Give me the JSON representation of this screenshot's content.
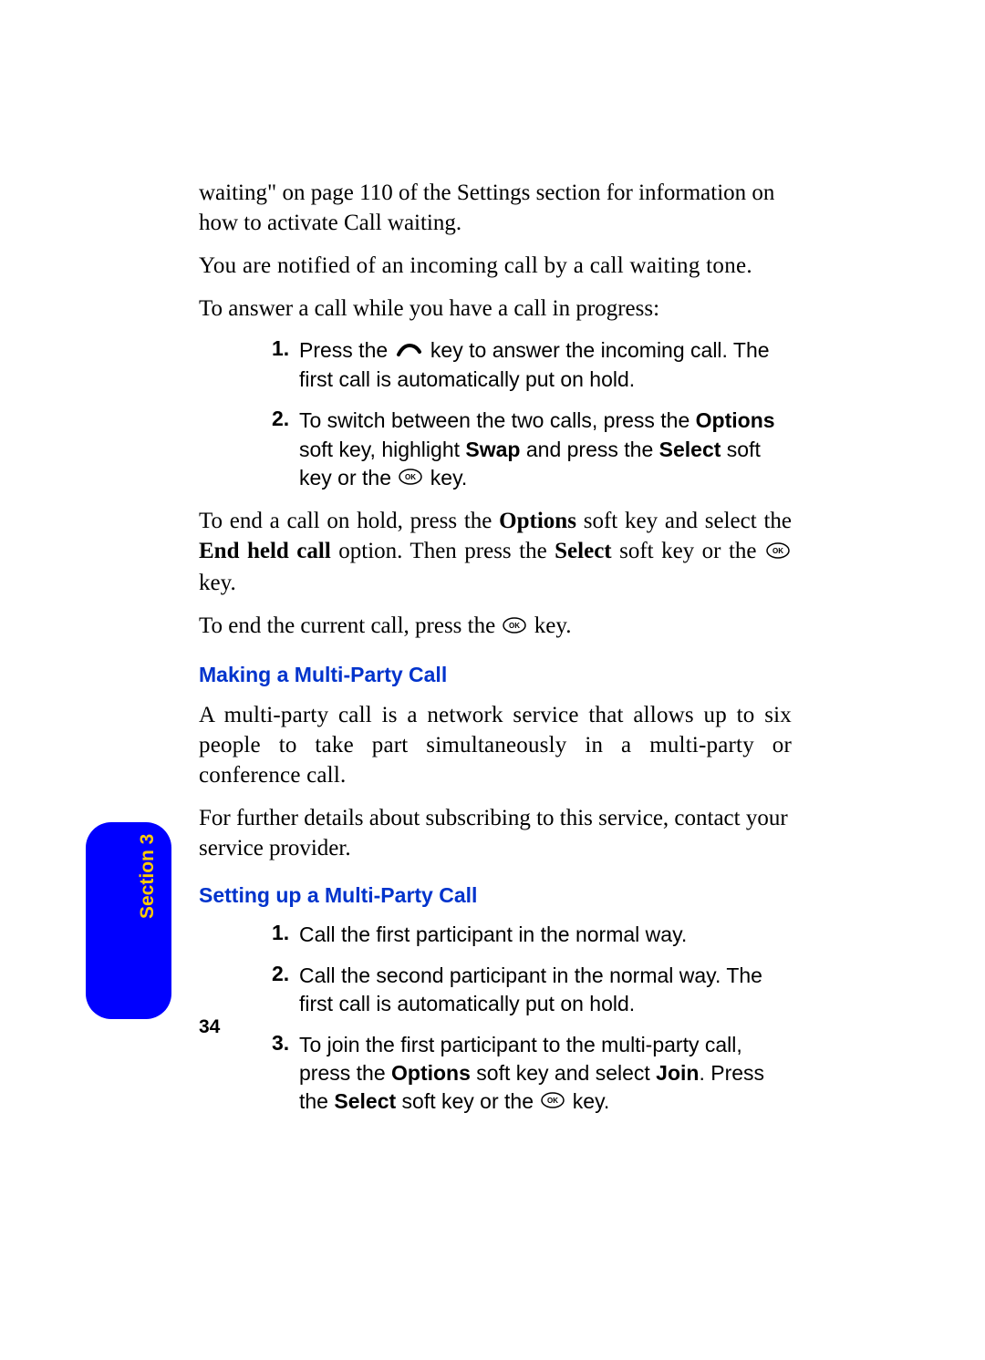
{
  "p1": "waiting\" on page 110 of the Settings section for information on how to activate Call waiting.",
  "p2": "You are notified of an incoming call by a call waiting tone.",
  "p3": "To answer a call while you have a call in progress:",
  "list1": {
    "item1_a": "Press the ",
    "item1_b": " key to answer the incoming call. The first call is automatically put on hold.",
    "item2_a": "To switch between the two calls, press the ",
    "item2_options": "Options",
    "item2_b": " soft key, highlight ",
    "item2_swap": "Swap",
    "item2_c": " and press the ",
    "item2_select": "Select",
    "item2_d": " soft key or the ",
    "item2_e": " key."
  },
  "p4_a": "To end a call on hold, press the ",
  "p4_options": "Options",
  "p4_b": " soft key and select the ",
  "p4_end": "End held call",
  "p4_c": " option. Then press the ",
  "p4_select": "Select",
  "p4_d": " soft key or the ",
  "p4_e": " key.",
  "p5_a": "To end the current call, press the ",
  "p5_b": " key.",
  "h1": "Making a Multi-Party Call",
  "p6": "A multi-party call is a network service that allows up to six people to take part simultaneously in a multi-party or conference call.",
  "p7": "For further details about subscribing to this service, contact your service provider.",
  "h2": "Setting up a Multi-Party Call",
  "list2": {
    "item1": "Call the first participant in the normal way.",
    "item2": "Call the second participant in the normal way. The first call is automatically put on hold.",
    "item3_a": "To join the first participant to the multi-party call, press the ",
    "item3_options": "Options",
    "item3_b": " soft key and select ",
    "item3_join": "Join",
    "item3_c": ". Press the ",
    "item3_select": "Select",
    "item3_d": " soft key or the ",
    "item3_e": " key."
  },
  "section_label": "Section 3",
  "page_num": "34"
}
